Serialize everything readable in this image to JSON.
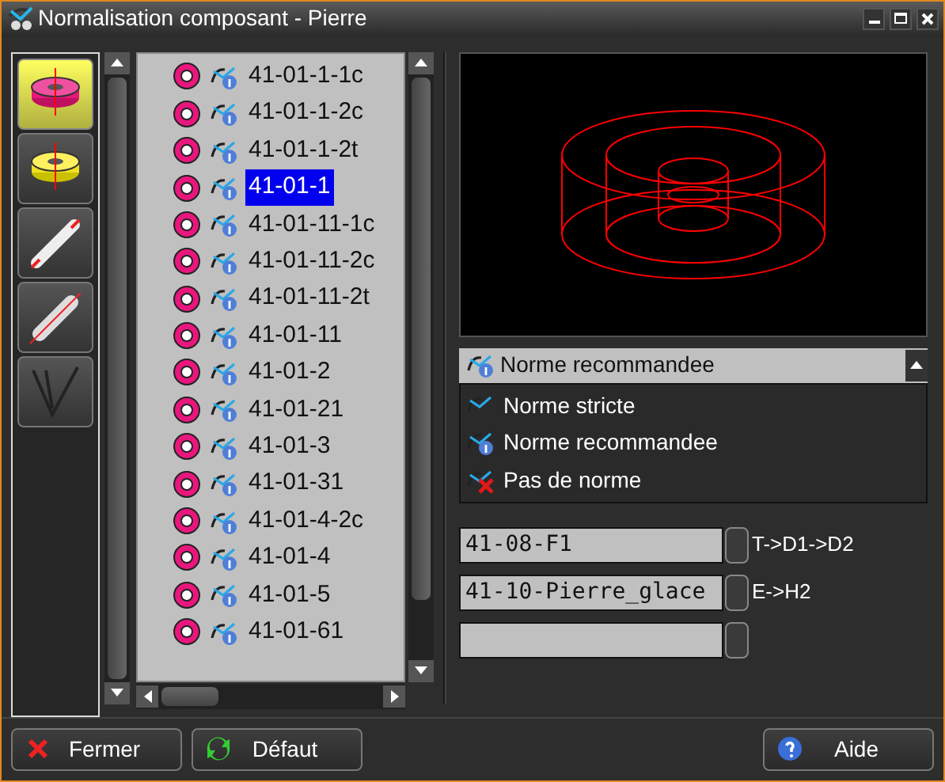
{
  "window": {
    "title": "Normalisation composant - Pierre"
  },
  "tools": [
    {
      "kind": "pink-ring",
      "selected": true
    },
    {
      "kind": "yellow-ring",
      "selected": false
    },
    {
      "kind": "pin",
      "selected": false
    },
    {
      "kind": "rod",
      "selected": false
    },
    {
      "kind": "pliers",
      "selected": false
    }
  ],
  "items": [
    {
      "label": "41-01-1-1c",
      "selected": false
    },
    {
      "label": "41-01-1-2c",
      "selected": false
    },
    {
      "label": "41-01-1-2t",
      "selected": false
    },
    {
      "label": "41-01-1",
      "selected": true
    },
    {
      "label": "41-01-11-1c",
      "selected": false
    },
    {
      "label": "41-01-11-2c",
      "selected": false
    },
    {
      "label": "41-01-11-2t",
      "selected": false
    },
    {
      "label": "41-01-11",
      "selected": false
    },
    {
      "label": "41-01-2",
      "selected": false
    },
    {
      "label": "41-01-21",
      "selected": false
    },
    {
      "label": "41-01-3",
      "selected": false
    },
    {
      "label": "41-01-31",
      "selected": false
    },
    {
      "label": "41-01-4-2c",
      "selected": false
    },
    {
      "label": "41-01-4",
      "selected": false
    },
    {
      "label": "41-01-5",
      "selected": false
    },
    {
      "label": "41-01-61",
      "selected": false
    }
  ],
  "norm_combo": {
    "value": "Norme recommandee",
    "kind": "recommended",
    "expanded": true,
    "options": [
      {
        "label": "Norme stricte",
        "kind": "strict"
      },
      {
        "label": "Norme recommandee",
        "kind": "recommended"
      },
      {
        "label": "Pas de norme",
        "kind": "none"
      }
    ]
  },
  "fields": [
    {
      "kind": "filled",
      "value": "41-08-F1",
      "label": "T->D1->D2"
    },
    {
      "kind": "filled",
      "value": "41-10-Pierre_glace",
      "label": "E->H2"
    },
    {
      "kind": "blank"
    }
  ],
  "buttons": [
    {
      "label": "Fermer",
      "kind": "close"
    },
    {
      "label": "Défaut",
      "kind": "default"
    },
    {
      "label": "Aide",
      "kind": "help"
    }
  ]
}
